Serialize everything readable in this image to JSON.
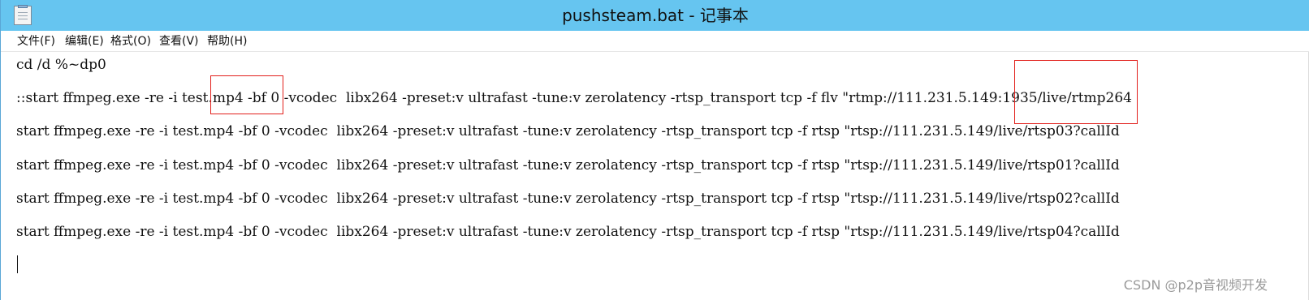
{
  "window": {
    "title": "pushsteam.bat - 记事本"
  },
  "menu": {
    "items": [
      {
        "label": "文件(F)"
      },
      {
        "label": "编辑(E)"
      },
      {
        "label": "格式(O)"
      },
      {
        "label": "查看(V)"
      },
      {
        "label": "帮助(H)"
      }
    ]
  },
  "editor": {
    "lines": [
      {
        "text": "cd /d %~dp0"
      },
      {
        "text": "::start ffmpeg.exe -re -i test.mp4 -bf 0 -vcodec  libx264 -preset:v ultrafast -tune:v zerolatency -rtsp_transport tcp -f flv \"rtmp://111.231.5.149:1935/live/rtmp264"
      },
      {
        "text": "start ffmpeg.exe -re -i test.mp4 -bf 0 -vcodec  libx264 -preset:v ultrafast -tune:v zerolatency -rtsp_transport tcp -f rtsp \"rtsp://111.231.5.149/live/rtsp03?callId"
      },
      {
        "text": "start ffmpeg.exe -re -i test.mp4 -bf 0 -vcodec  libx264 -preset:v ultrafast -tune:v zerolatency -rtsp_transport tcp -f rtsp \"rtsp://111.231.5.149/live/rtsp01?callId"
      },
      {
        "text": "start ffmpeg.exe -re -i test.mp4 -bf 0 -vcodec  libx264 -preset:v ultrafast -tune:v zerolatency -rtsp_transport tcp -f rtsp \"rtsp://111.231.5.149/live/rtsp02?callId"
      },
      {
        "text": "start ffmpeg.exe -re -i test.mp4 -bf 0 -vcodec  libx264 -preset:v ultrafast -tune:v zerolatency -rtsp_transport tcp -f rtsp \"rtsp://111.231.5.149/live/rtsp04?callId"
      }
    ]
  },
  "watermark": {
    "text": "CSDN @p2p音视频开发"
  },
  "colors": {
    "titlebar": "#66c5f0",
    "highlight": "#e2201c",
    "text": "#111111"
  },
  "icons": {
    "app": "notepad-icon"
  }
}
